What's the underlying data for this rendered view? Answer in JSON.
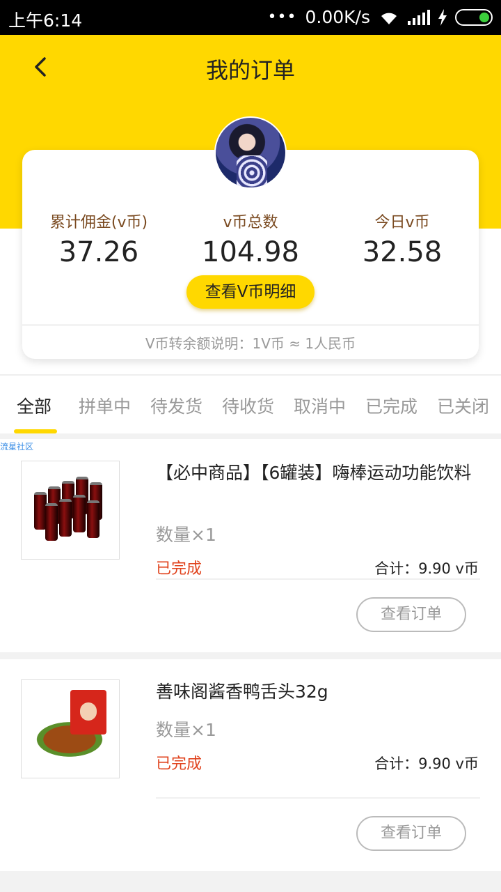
{
  "status_bar": {
    "time": "上午6:14",
    "dots": "•••",
    "speed": "0.00K/s"
  },
  "header": {
    "title": "我的订单"
  },
  "summary": {
    "stats": [
      {
        "label": "累计佣金(v币)",
        "value": "37.26"
      },
      {
        "label": "v币总数",
        "value": "104.98"
      },
      {
        "label": "今日v币",
        "value": "32.58"
      }
    ],
    "detail_button": "查看V币明细",
    "note": "V币转余额说明：1V币 ≈ 1人民币"
  },
  "tabs": [
    "全部",
    "拼单中",
    "待发货",
    "待收货",
    "取消中",
    "已完成",
    "已关闭"
  ],
  "active_tab": "全部",
  "watermark": "流星社区",
  "orders": [
    {
      "name": "【必中商品】【6罐装】嗨棒运动功能饮料",
      "quantity": "数量×1",
      "status": "已完成",
      "total": "合计：9.90 v币",
      "button": "查看订单"
    },
    {
      "name": "善味阁酱香鸭舌头32g",
      "quantity": "数量×1",
      "status": "已完成",
      "total": "合计：9.90 v币",
      "button": "查看订单"
    }
  ],
  "colors": {
    "brand_yellow": "#FFD800",
    "status_red": "#e0421c"
  }
}
